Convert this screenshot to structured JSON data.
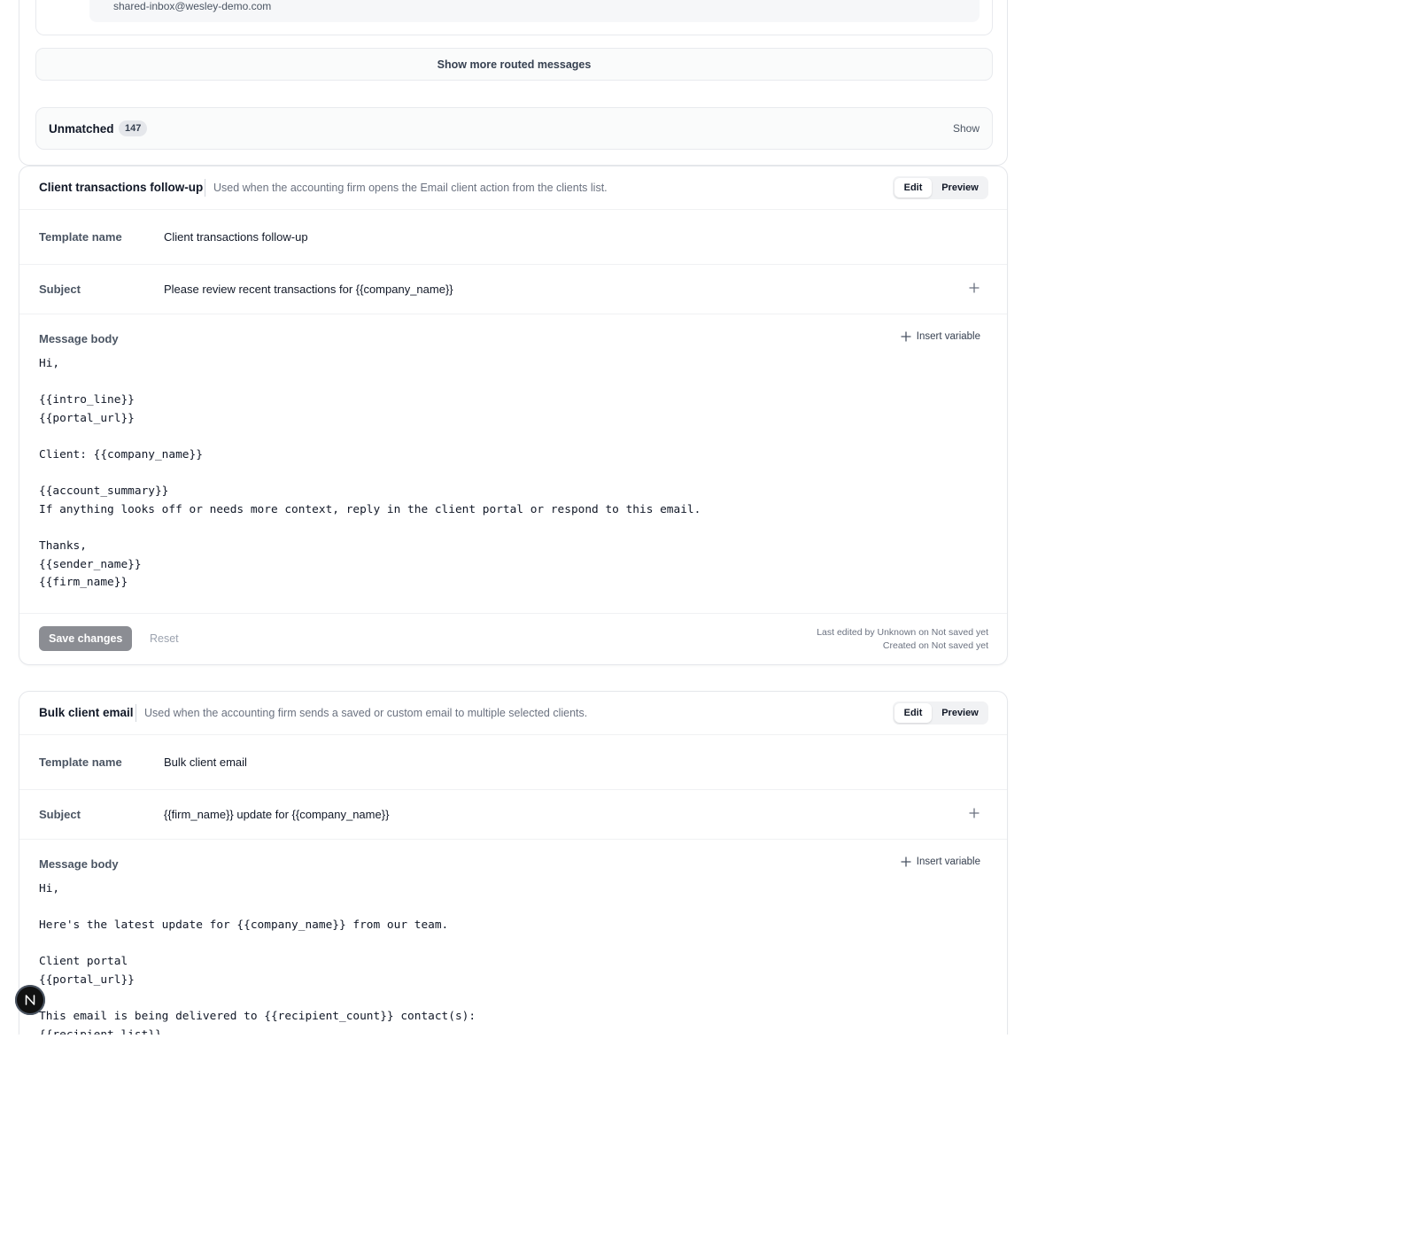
{
  "routed": {
    "email": "shared-inbox@wesley-demo.com",
    "show_more_label": "Show more routed messages"
  },
  "unmatched": {
    "label": "Unmatched",
    "count": "147",
    "show_label": "Show"
  },
  "templates": [
    {
      "title": "Client transactions follow-up",
      "description": "Used when the accounting firm opens the Email client action from the clients list.",
      "mode_edit": "Edit",
      "mode_preview": "Preview",
      "mode_selected": "Edit",
      "name_label": "Template name",
      "name_value": "Client transactions follow-up",
      "subject_label": "Subject",
      "subject_value": "Please review recent transactions for {{company_name}}",
      "body_label": "Message body",
      "insert_variable_label": "Insert variable",
      "body": "Hi,\n\n{{intro_line}}\n{{portal_url}}\n\nClient: {{company_name}}\n\n{{account_summary}}\nIf anything looks off or needs more context, reply in the client portal or respond to this email.\n\nThanks,\n{{sender_name}}\n{{firm_name}}",
      "save_label": "Save changes",
      "reset_label": "Reset",
      "last_edited": "Last edited by Unknown on Not saved yet",
      "created": "Created on Not saved yet"
    },
    {
      "title": "Bulk client email",
      "description": "Used when the accounting firm sends a saved or custom email to multiple selected clients.",
      "mode_edit": "Edit",
      "mode_preview": "Preview",
      "mode_selected": "Edit",
      "name_label": "Template name",
      "name_value": "Bulk client email",
      "subject_label": "Subject",
      "subject_value": "{{firm_name}} update for {{company_name}}",
      "body_label": "Message body",
      "insert_variable_label": "Insert variable",
      "body": "Hi,\n\nHere's the latest update for {{company_name}} from our team.\n\nClient portal\n{{portal_url}}\n\nThis email is being delivered to {{recipient_count}} contact(s):\n{{recipient_list}}"
    }
  ],
  "avatar_initial": "N",
  "colors": {
    "save_button": "#8b8d93",
    "avatar_bg": "#111111"
  }
}
